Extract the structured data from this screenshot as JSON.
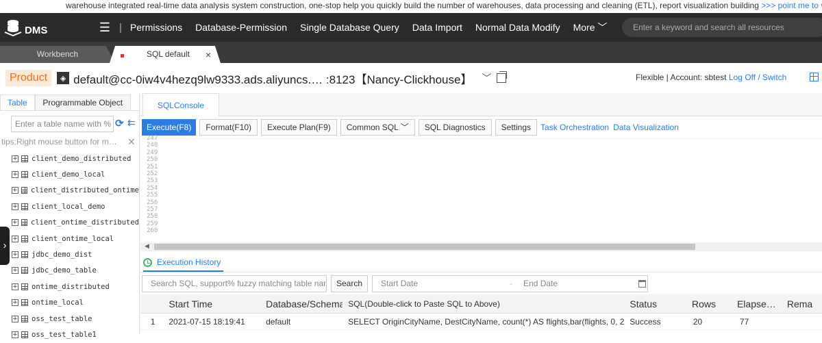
{
  "banner": {
    "text": "warehouse integrated real-time data analysis system construction, one-stop help you quickly build the number of warehouses, data processing and cleaning (ETL), report visualization building ",
    "link": ">>> point me to view <"
  },
  "topnav": {
    "logo": "DMS",
    "separator": "|",
    "items": [
      "Permissions",
      "Database-Permission",
      "Single Database Query",
      "Data Import",
      "Normal Data Modify",
      "More"
    ],
    "search_placeholder": "Enter a keyword and search all resources"
  },
  "tabs": {
    "workbench": "Workbench",
    "active": "SQL default",
    "close": "×"
  },
  "infobar": {
    "product": "Product",
    "connection": "default@cc-0iw4v4hezq9lw9333.ads.aliyuncs.… :8123【Nancy-Clickhouse】",
    "mode": "Flexible | Account: sbtest",
    "logoff": "Log Off",
    "slash": " / ",
    "switch": "Switch"
  },
  "leftpanel": {
    "tab_table": "Table",
    "tab_programmable": "Programmable Object",
    "search_placeholder": "Enter a table name with %",
    "tips": "tips:Right mouse button for m…",
    "tables": [
      "client_demo_distributed",
      "client_demo_local",
      "client_distributed_ontime",
      "client_local_demo",
      "client_ontime_distributed",
      "client_ontime_local",
      "jdbc_demo_dist",
      "jdbc_demo_table",
      "ontime_distributed",
      "ontime_local",
      "oss_test_table",
      "oss_test_table1"
    ]
  },
  "console": {
    "tab": "SQLConsole",
    "toolbar": {
      "execute": "Execute(F8)",
      "format": "Format(F10)",
      "plan": "Execute Plan(F9)",
      "common": "Common SQL",
      "diagnostics": "SQL Diagnostics",
      "settings": "Settings",
      "task": "Task Orchestration",
      "visual": "Data Visualization"
    },
    "line_numbers": [
      "247",
      "248",
      "249",
      "250",
      "251",
      "252",
      "253",
      "254",
      "255",
      "256",
      "257",
      "258",
      "259",
      "260"
    ]
  },
  "history": {
    "title": "Execution History",
    "search_placeholder": "Search SQL, support% fuzzy matching table nar",
    "search_btn": "Search",
    "start_date": "Start Date",
    "dash": "-",
    "end_date": "End Date",
    "columns": [
      "",
      "Start Time",
      "Database/Schema",
      "SQL(Double-click to Paste SQL to Above)",
      "Status",
      "Rows",
      "Elapse…",
      "Rema"
    ],
    "rows": [
      {
        "n": "1",
        "start": "2021-07-15 18:19:41",
        "db": "default",
        "sql": "SELECT OriginCityName, DestCityName, count(*) AS flights,bar(flights, 0, 20000",
        "status": "Success",
        "rows": "20",
        "elapsed": "77",
        "remark": ""
      }
    ]
  }
}
